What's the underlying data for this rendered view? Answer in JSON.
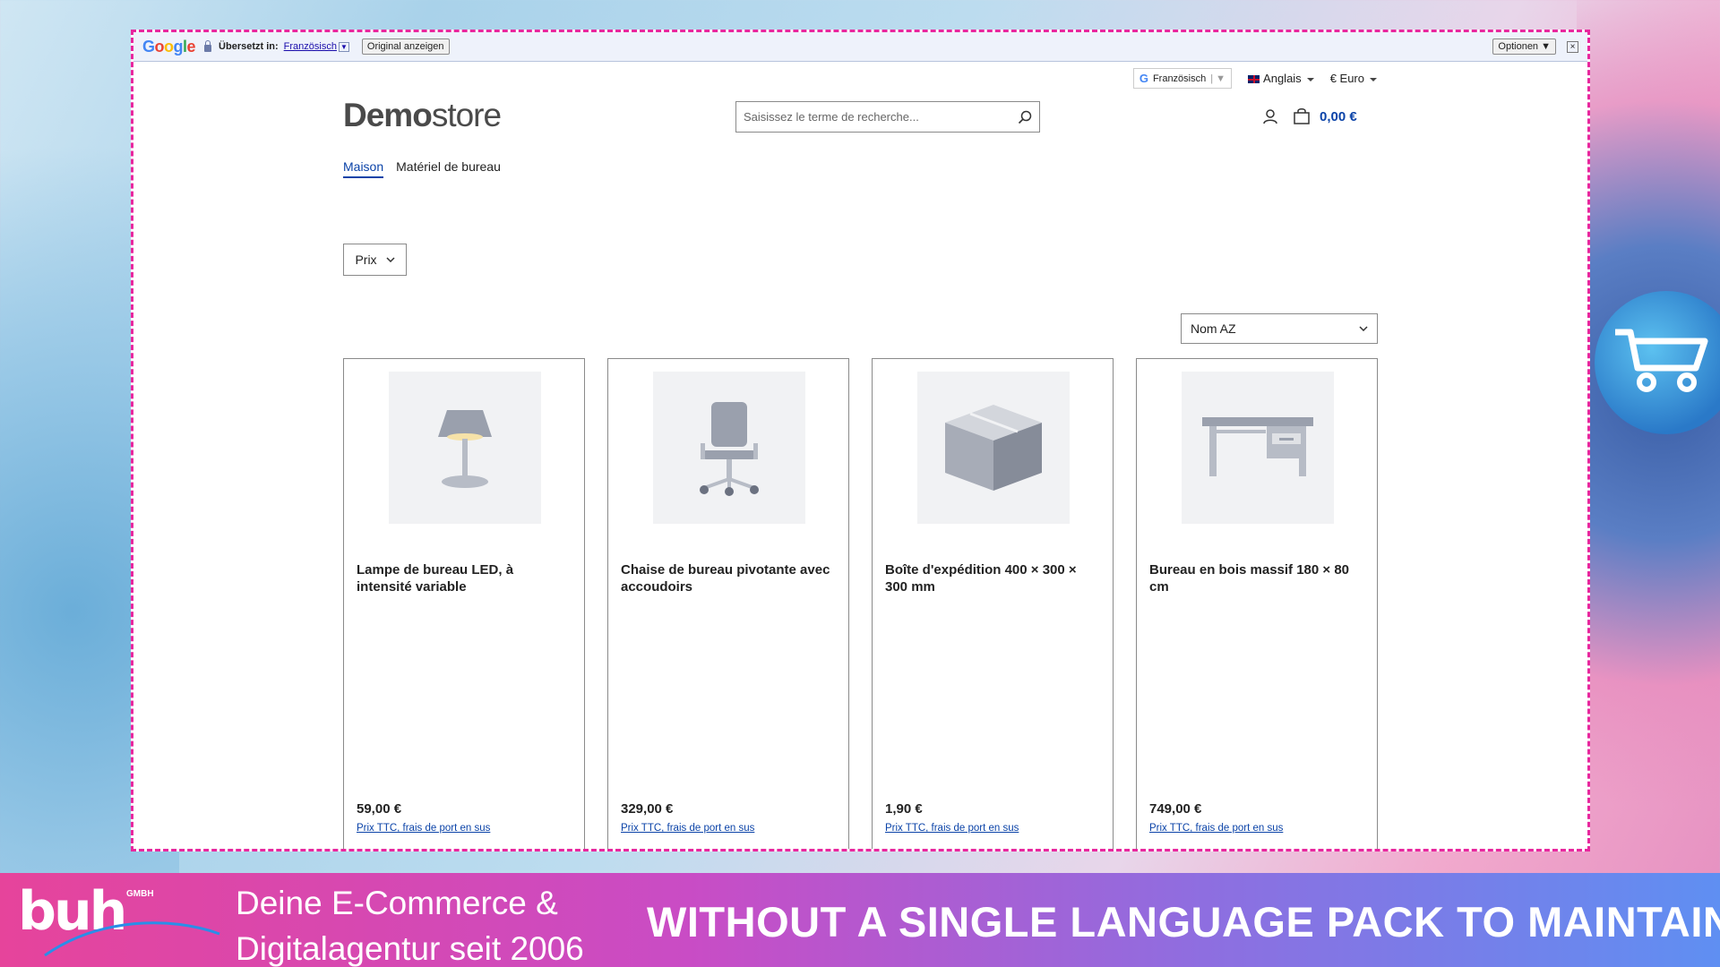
{
  "translate_bar": {
    "logo": [
      "G",
      "o",
      "o",
      "g",
      "l",
      "e"
    ],
    "translated_label": "Übersetzt in:",
    "language": "Französisch",
    "original_button": "Original anzeigen",
    "options_button": "Optionen ▼",
    "close": "×"
  },
  "store": {
    "google_selector": "Französisch",
    "language": "Anglais",
    "currency": "€ Euro",
    "logo_bold": "Demo",
    "logo_light": "store",
    "search_placeholder": "Saisissez le terme de recherche...",
    "cart_total": "0,00 €",
    "nav": [
      "Maison",
      "Matériel de bureau"
    ],
    "filter_label": "Prix",
    "sort_label": "Nom AZ",
    "products": [
      {
        "title": "Lampe de bureau LED, à intensité variable",
        "price": "59,00 €",
        "tax": "Prix TTC, frais de port en sus",
        "icon": "lamp-icon"
      },
      {
        "title": "Chaise de bureau pivotante avec accoudoirs",
        "price": "329,00 €",
        "tax": "Prix TTC, frais de port en sus",
        "icon": "chair-icon"
      },
      {
        "title": "Boîte d'expédition 400 × 300 × 300 mm",
        "price": "1,90 €",
        "tax": "Prix TTC, frais de port en sus",
        "icon": "box-icon"
      },
      {
        "title": "Bureau en bois massif 180 × 80 cm",
        "price": "749,00 €",
        "tax": "Prix TTC, frais de port en sus",
        "icon": "desk-icon"
      }
    ]
  },
  "banner": {
    "brand": "buh",
    "brand_suffix": "GMBH",
    "tagline_1": "Deine E-Commerce &",
    "tagline_2": "Digitalagentur seit 2006",
    "claim": "WITHOUT A SINGLE LANGUAGE PACK TO MAINTAIN"
  },
  "colors": {
    "accent": "#0b43a8",
    "frame": "#e8279e"
  }
}
